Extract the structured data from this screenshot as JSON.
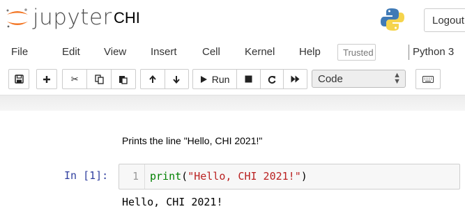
{
  "header": {
    "logo_text": "jupyter",
    "notebook_title": "CHI",
    "logout_label": "Logout"
  },
  "menu": {
    "items": [
      "File",
      "Edit",
      "View",
      "Insert",
      "Cell",
      "Kernel",
      "Help"
    ],
    "trusted_label": "Trusted",
    "kernel_name": "Python 3"
  },
  "toolbar": {
    "run_label": "Run",
    "cell_type": "Code"
  },
  "cells": {
    "markdown_text": "Prints the line \"Hello, CHI 2021!\"",
    "prompt": "In [1]:",
    "line_number": "1",
    "code_fn": "print",
    "code_open": "(",
    "code_string": "\"Hello, CHI 2021!\"",
    "code_close": ")",
    "output": "Hello, CHI 2021!"
  },
  "colors": {
    "prompt": "#303f9f",
    "builtin": "#008000",
    "string": "#ba2121",
    "jupyter_orange": "#f37726"
  },
  "icons": [
    "jupyter-logo-icon",
    "python-logo-icon",
    "save-icon",
    "plus-icon",
    "cut-icon",
    "copy-icon",
    "paste-icon",
    "arrow-up-icon",
    "arrow-down-icon",
    "run-icon",
    "stop-icon",
    "restart-icon",
    "fast-forward-icon",
    "keyboard-icon"
  ]
}
